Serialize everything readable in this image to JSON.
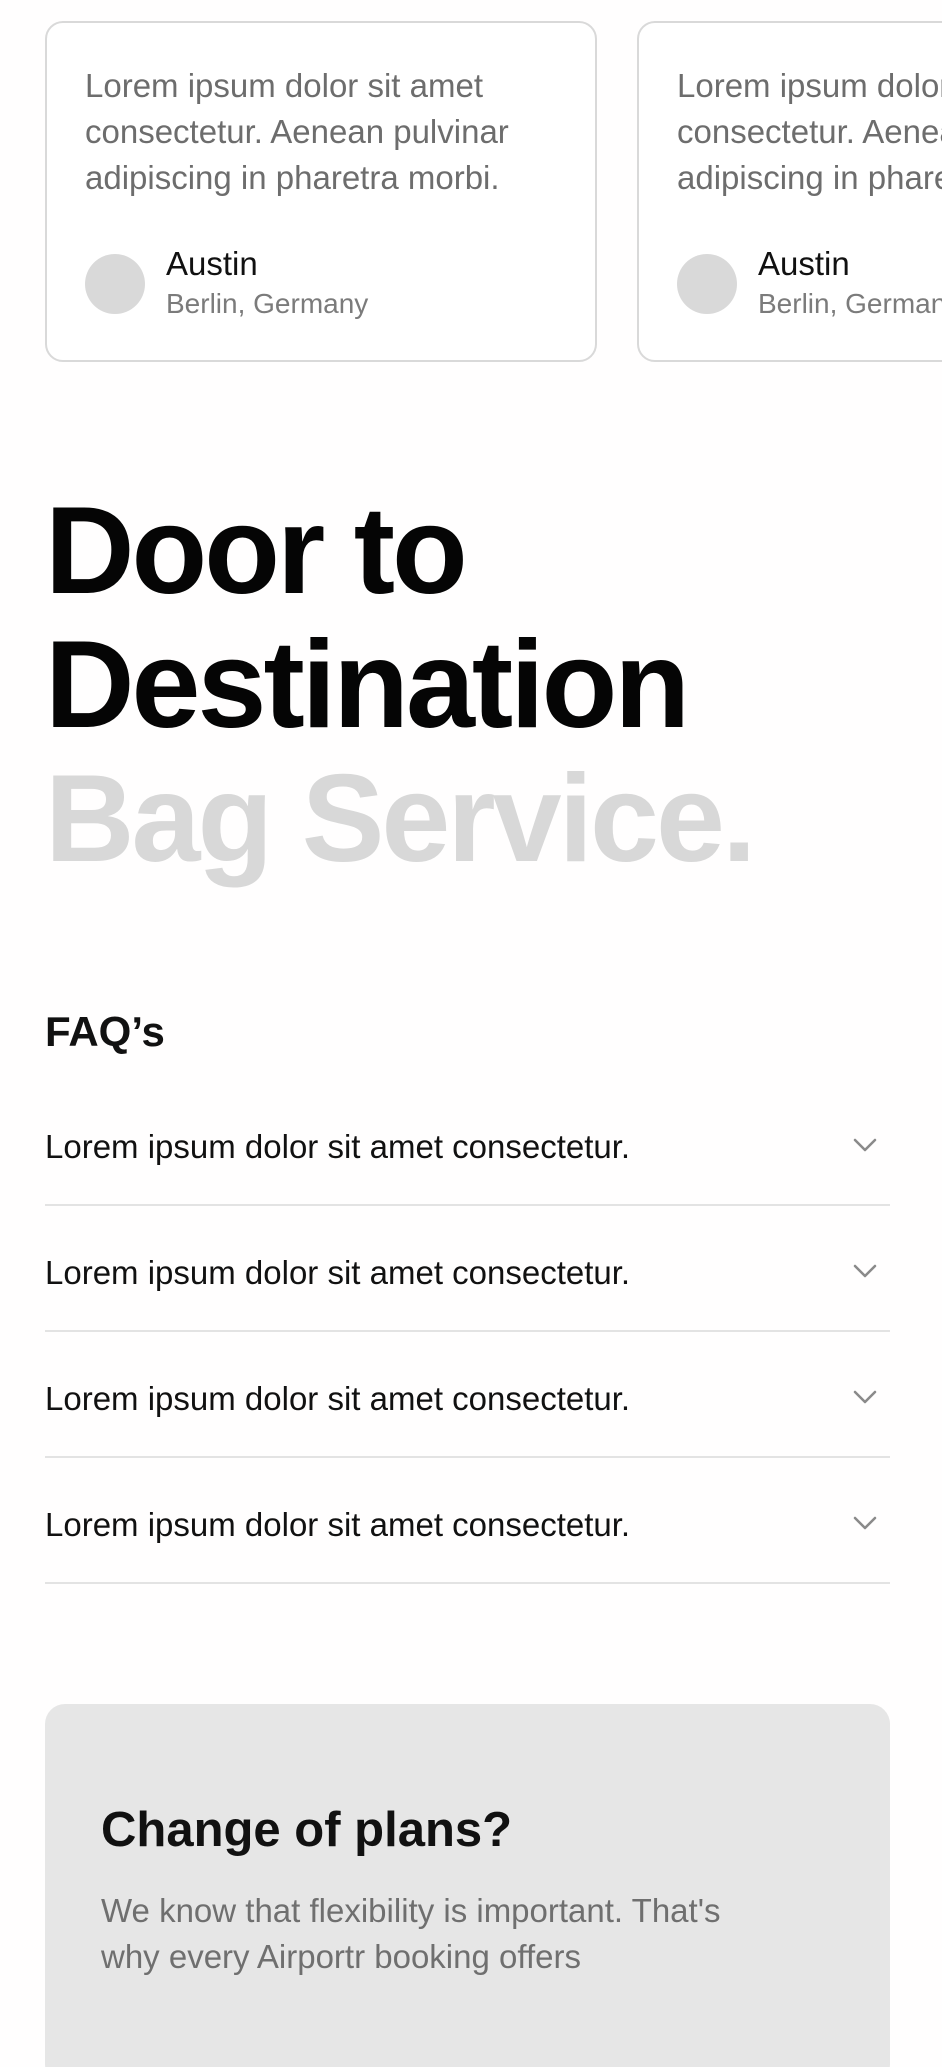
{
  "testimonials": [
    {
      "quote": "Lorem ipsum dolor sit amet consectetur. Aenean pulvinar adipiscing in pharetra morbi.",
      "author": "Austin",
      "location": "Berlin, Germany"
    },
    {
      "quote": "Lorem ipsum dolor sit amet consectetur. Aenean pulvinar adipiscing in pharetra morbi.",
      "author": "Austin",
      "location": "Berlin, Germany"
    }
  ],
  "hero": {
    "line1": "Door to",
    "line2": "Destination",
    "line3": "Bag Service."
  },
  "faq": {
    "title": "FAQ’s",
    "items": [
      {
        "question": "Lorem ipsum dolor sit amet consectetur.",
        "icon": "chevron-down-icon"
      },
      {
        "question": "Lorem ipsum dolor sit amet consectetur.",
        "icon": "chevron-down-icon"
      },
      {
        "question": "Lorem ipsum dolor sit amet consectetur.",
        "icon": "chevron-down-icon"
      },
      {
        "question": "Lorem ipsum dolor sit amet consectetur.",
        "icon": "chevron-down-icon"
      }
    ]
  },
  "plans": {
    "title": "Change of plans?",
    "body": "We know that flexibility is important. That's why every Airportr booking offers"
  },
  "colors": {
    "background": "#fffefe",
    "card_border": "#d9d9d9",
    "avatar": "#d9d9d9",
    "hero_dark": "#050505",
    "hero_light": "#d8d8d8",
    "divider": "#e3e3e3",
    "plans_bg": "#e6e6e6"
  }
}
